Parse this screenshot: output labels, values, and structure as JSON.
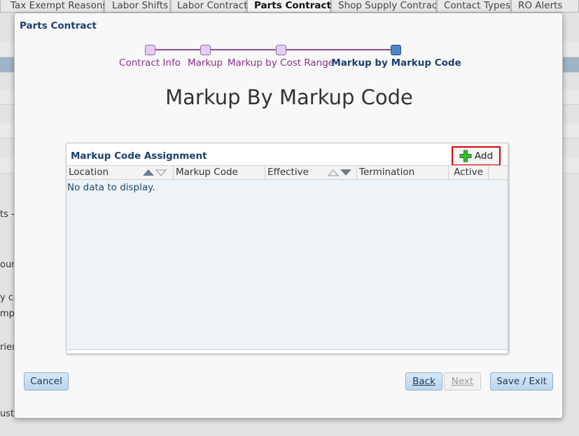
{
  "background": {
    "tabs": [
      {
        "label": "Tax Exempt Reasons",
        "active": false
      },
      {
        "label": "Labor Shifts",
        "active": false
      },
      {
        "label": "Labor Contract",
        "active": false
      },
      {
        "label": "Parts Contract",
        "active": true
      },
      {
        "label": "Shop Supply Contract",
        "active": false
      },
      {
        "label": "Contact Types",
        "active": false
      },
      {
        "label": "RO Alerts",
        "active": false
      }
    ],
    "fragments": [
      "ts -",
      "oun",
      "y co",
      "mpl",
      "rien",
      "usto"
    ]
  },
  "dialog": {
    "title": "Parts Contract",
    "heading": "Markup By Markup Code"
  },
  "stepper": {
    "steps": [
      {
        "label": "Contract Info",
        "state": "done"
      },
      {
        "label": "Markup",
        "state": "done"
      },
      {
        "label": "Markup by Cost Range",
        "state": "done"
      },
      {
        "label": "Markup by Markup Code",
        "state": "current"
      }
    ]
  },
  "panel": {
    "title": "Markup Code Assignment",
    "add_label": "Add",
    "columns": [
      "Location",
      "Markup Code",
      "Effective",
      "Termination",
      "Active"
    ],
    "empty_text": "No data to display."
  },
  "footer": {
    "cancel_label": "Cancel",
    "back_label": "Back",
    "next_label": "Next",
    "save_label": "Save / Exit"
  },
  "colors": {
    "accent": "#1c3f6e",
    "step_done": "#e4cdf3",
    "step_current": "#4f86c6",
    "highlight": "#e00000"
  }
}
